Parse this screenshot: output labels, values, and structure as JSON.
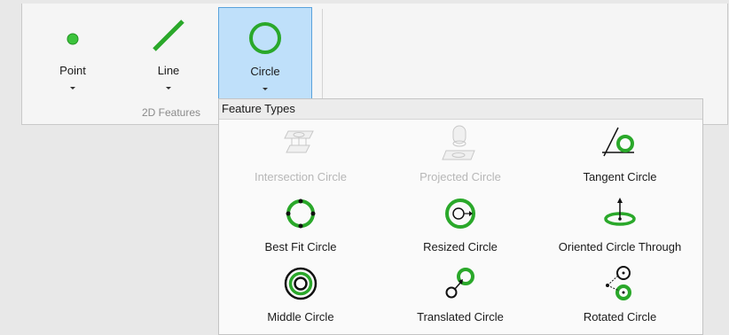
{
  "ribbon": {
    "buttons": [
      {
        "label": "Point",
        "icon": "point-icon"
      },
      {
        "label": "Line",
        "icon": "line-icon"
      },
      {
        "label": "Circle",
        "icon": "circle-icon",
        "selected": true
      }
    ],
    "group_label": "2D Features"
  },
  "dropdown": {
    "header": "Feature Types",
    "items": [
      {
        "label": "Intersection Circle",
        "icon": "intersection-circle-icon",
        "enabled": false
      },
      {
        "label": "Projected Circle",
        "icon": "projected-circle-icon",
        "enabled": false
      },
      {
        "label": "Tangent Circle",
        "icon": "tangent-circle-icon",
        "enabled": true
      },
      {
        "label": "Best Fit Circle",
        "icon": "best-fit-circle-icon",
        "enabled": true
      },
      {
        "label": "Resized Circle",
        "icon": "resized-circle-icon",
        "enabled": true
      },
      {
        "label": "Oriented Circle Through",
        "icon": "oriented-circle-icon",
        "enabled": true
      },
      {
        "label": "Middle Circle",
        "icon": "middle-circle-icon",
        "enabled": true
      },
      {
        "label": "Translated Circle",
        "icon": "translated-circle-icon",
        "enabled": true
      },
      {
        "label": "Rotated Circle",
        "icon": "rotated-circle-icon",
        "enabled": true
      }
    ]
  },
  "colors": {
    "accent_green": "#2aa82a",
    "selected_bg": "#bfe0fa",
    "selected_border": "#5aa3dc",
    "disabled_text": "#b7b7b7"
  }
}
